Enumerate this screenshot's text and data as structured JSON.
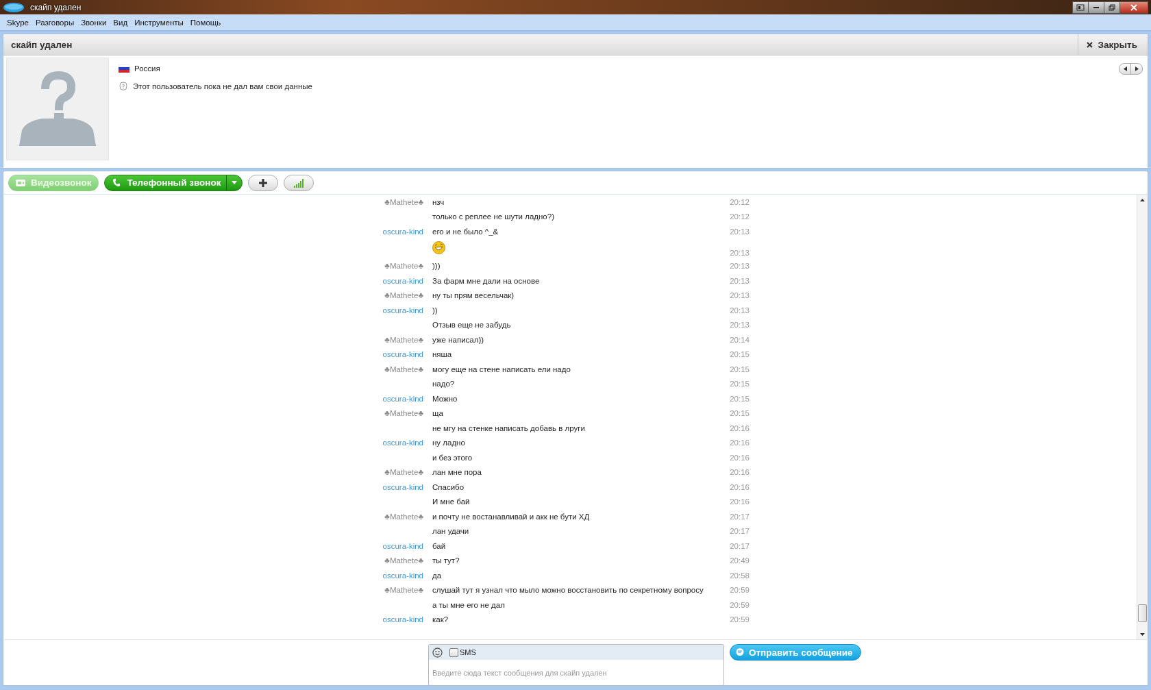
{
  "window": {
    "title": "скайп удален"
  },
  "menu": [
    "Skype",
    "Разговоры",
    "Звонки",
    "Вид",
    "Инструменты",
    "Помощь"
  ],
  "contact": {
    "name": "скайп удален",
    "close_label": "Закрыть",
    "country": "Россия",
    "status_text": "Этот пользователь пока не дал вам свои данные"
  },
  "call_buttons": [
    {
      "label": "Видеозвонок",
      "kind": "video",
      "disabled": true
    },
    {
      "label": "Телефонный звонок",
      "kind": "phone",
      "disabled": false
    }
  ],
  "messages": [
    {
      "kind": "text",
      "sender": "♣Mathete♣",
      "color": "#8a8a8a",
      "text": "нзч",
      "time": "20:12"
    },
    {
      "kind": "text",
      "text": "только с реплее не шути ладно?)",
      "time": "20:12"
    },
    {
      "kind": "text",
      "sender": "oscura-kind",
      "color": "#3a96dd",
      "text": "его и не было ^_&",
      "time": "20:13"
    },
    {
      "kind": "emoji",
      "time": "20:13"
    },
    {
      "kind": "text",
      "sender": "♣Mathete♣",
      "color": "#8a8a8a",
      "text": ")))",
      "time": "20:13"
    },
    {
      "kind": "text",
      "sender": "oscura-kind",
      "color": "#3a96dd",
      "text": "За фарм мне дали на основе",
      "time": "20:13"
    },
    {
      "kind": "text",
      "sender": "♣Mathete♣",
      "color": "#8a8a8a",
      "text": "ну ты прям весельчак)",
      "time": "20:13"
    },
    {
      "kind": "text",
      "sender": "oscura-kind",
      "color": "#3a96dd",
      "text": "))",
      "time": "20:13"
    },
    {
      "kind": "text",
      "text": "Отзыв еще не забудь",
      "time": "20:13"
    },
    {
      "kind": "text",
      "sender": "♣Mathete♣",
      "color": "#8a8a8a",
      "text": "уже написал))",
      "time": "20:14"
    },
    {
      "kind": "text",
      "sender": "oscura-kind",
      "color": "#3a96dd",
      "text": "няша",
      "time": "20:15"
    },
    {
      "kind": "text",
      "sender": "♣Mathete♣",
      "color": "#8a8a8a",
      "text": "могу еще на стене написать ели надо",
      "time": "20:15"
    },
    {
      "kind": "text",
      "text": "надо?",
      "time": "20:15"
    },
    {
      "kind": "text",
      "sender": "oscura-kind",
      "color": "#3a96dd",
      "text": "Можно",
      "time": "20:15"
    },
    {
      "kind": "text",
      "sender": "♣Mathete♣",
      "color": "#8a8a8a",
      "text": "ща",
      "time": "20:15"
    },
    {
      "kind": "text",
      "text": "не мгу на стенке написать добавь в лруги",
      "time": "20:16"
    },
    {
      "kind": "text",
      "sender": "oscura-kind",
      "color": "#3a96dd",
      "text": "ну ладно",
      "time": "20:16"
    },
    {
      "kind": "text",
      "text": "и без этого",
      "time": "20:16"
    },
    {
      "kind": "text",
      "sender": "♣Mathete♣",
      "color": "#8a8a8a",
      "text": "лан мне пора",
      "time": "20:16"
    },
    {
      "kind": "text",
      "sender": "oscura-kind",
      "color": "#3a96dd",
      "text": "Спасибо",
      "time": "20:16"
    },
    {
      "kind": "text",
      "text": "И мне бай",
      "time": "20:16"
    },
    {
      "kind": "text",
      "sender": "♣Mathete♣",
      "color": "#8a8a8a",
      "text": "и почту не востанавливай и акк не бути ХД",
      "time": "20:17"
    },
    {
      "kind": "text",
      "text": "лан удачи",
      "time": "20:17"
    },
    {
      "kind": "text",
      "sender": "oscura-kind",
      "color": "#3a96dd",
      "text": "бай",
      "time": "20:17"
    },
    {
      "kind": "text",
      "sender": "♣Mathete♣",
      "color": "#8a8a8a",
      "text": "ты тут?",
      "time": "20:49"
    },
    {
      "kind": "text",
      "sender": "oscura-kind",
      "color": "#3a96dd",
      "text": "да",
      "time": "20:58"
    },
    {
      "kind": "text",
      "sender": "♣Mathete♣",
      "color": "#8a8a8a",
      "text": "слушай тут я узнал что мыло можно восстановить по секретному вопросу",
      "time": "20:59"
    },
    {
      "kind": "text",
      "text": "а ты мне его не дал",
      "time": "20:59"
    },
    {
      "kind": "text",
      "sender": "oscura-kind",
      "color": "#3a96dd",
      "text": "как?",
      "time": "20:59"
    }
  ],
  "composer": {
    "sms_label": "SMS",
    "sms_checked": false,
    "placeholder": "Введите сюда текст сообщения для скайп удален",
    "send_label": "Отправить сообщение"
  }
}
